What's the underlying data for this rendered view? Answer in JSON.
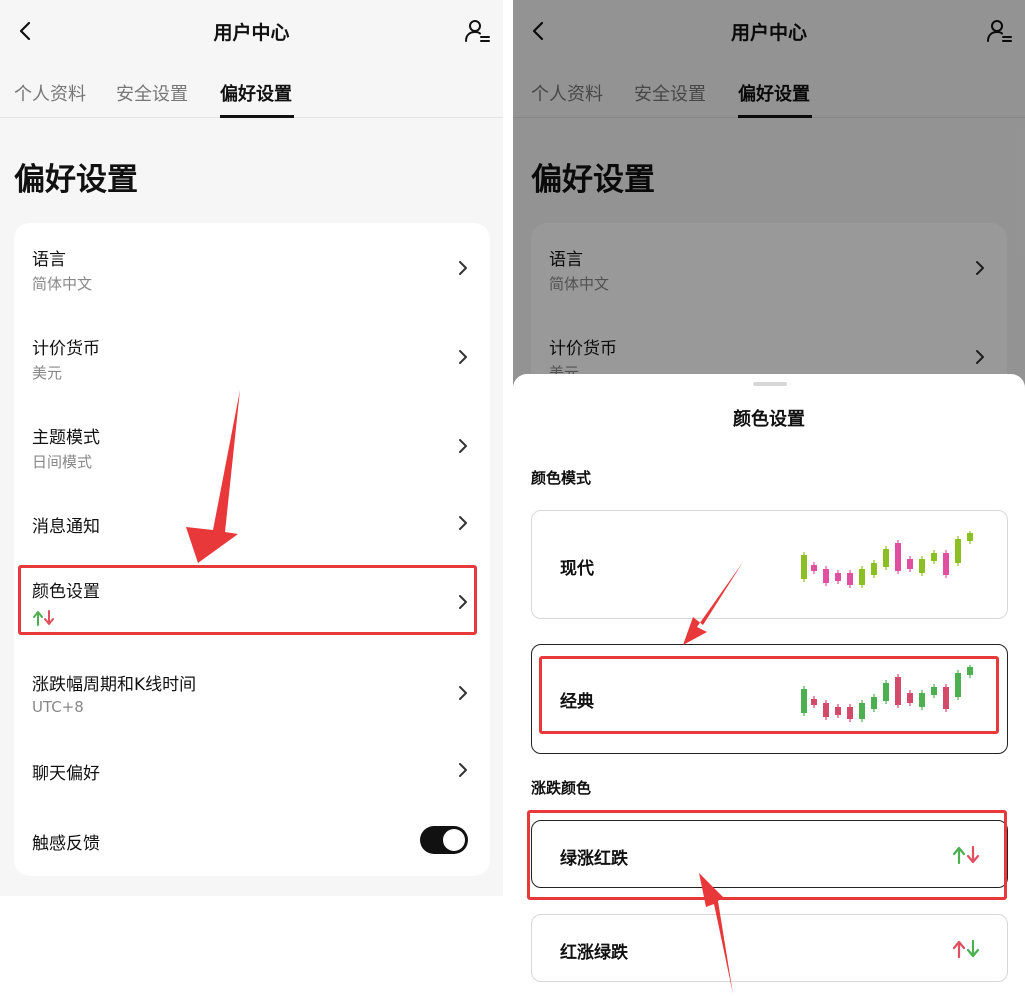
{
  "left": {
    "header": {
      "title": "用户中心"
    },
    "tabs": [
      {
        "label": "个人资料"
      },
      {
        "label": "安全设置"
      },
      {
        "label": "偏好设置"
      }
    ],
    "page_title": "偏好设置",
    "settings": [
      {
        "label": "语言",
        "value": "简体中文"
      },
      {
        "label": "计价货币",
        "value": "美元"
      },
      {
        "label": "主题模式",
        "value": "日间模式"
      },
      {
        "label": "消息通知",
        "value": ""
      },
      {
        "label": "颜色设置",
        "value": ""
      },
      {
        "label": "涨跌幅周期和K线时间",
        "value": "UTC+8"
      },
      {
        "label": "聊天偏好",
        "value": ""
      },
      {
        "label": "触感反馈",
        "value": "",
        "toggle_on": true
      }
    ]
  },
  "right": {
    "header": {
      "title": "用户中心"
    },
    "tabs": [
      {
        "label": "个人资料"
      },
      {
        "label": "安全设置"
      },
      {
        "label": "偏好设置"
      }
    ],
    "page_title": "偏好设置",
    "settings_visible": [
      {
        "label": "语言",
        "value": "简体中文"
      },
      {
        "label": "计价货币",
        "value": "美元"
      }
    ],
    "sheet": {
      "title": "颜色设置",
      "color_mode_label": "颜色模式",
      "color_modes": [
        {
          "label": "现代",
          "selected": false,
          "up_color": "#8cbf26",
          "down_color": "#e04fa0"
        },
        {
          "label": "经典",
          "selected": true,
          "up_color": "#4caf50",
          "down_color": "#d44a6a"
        }
      ],
      "direction_label": "涨跌颜色",
      "directions": [
        {
          "label": "绿涨红跌",
          "selected": true,
          "up_color": "#4caf50",
          "down_color": "#e05060"
        },
        {
          "label": "红涨绿跌",
          "selected": false,
          "up_color": "#e05060",
          "down_color": "#4caf50"
        }
      ]
    }
  },
  "colors": {
    "highlight": "#e8383a",
    "up_green": "#4caf50",
    "down_red": "#e05060"
  },
  "icons": {
    "back": "chevron-left-icon",
    "user": "user-settings-icon",
    "row": "chevron-right-icon"
  }
}
